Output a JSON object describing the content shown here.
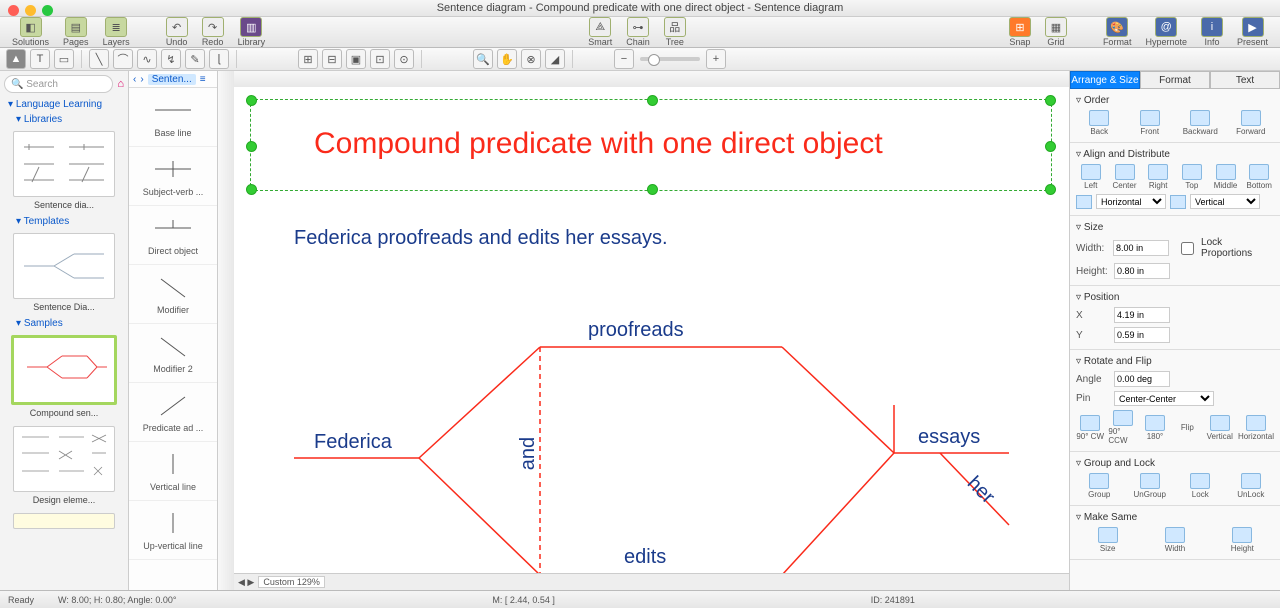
{
  "window": {
    "title": "Sentence diagram - Compound predicate with one direct object - Sentence diagram",
    "traffic": {
      "close": "#ff5f57",
      "min": "#febc2e",
      "max": "#28c840"
    }
  },
  "toolbar": {
    "left": [
      {
        "label": "Solutions",
        "icon": "📦"
      },
      {
        "label": "Pages",
        "icon": "📄"
      },
      {
        "label": "Layers",
        "icon": "📚"
      }
    ],
    "undo": "Undo",
    "redo": "Redo",
    "library": "Library",
    "mid": [
      {
        "label": "Smart",
        "icon": "▵"
      },
      {
        "label": "Chain",
        "icon": "⛓"
      },
      {
        "label": "Tree",
        "icon": "品"
      }
    ],
    "snap": "Snap",
    "grid": "Grid",
    "right": [
      {
        "label": "Format",
        "icon": "🎨"
      },
      {
        "label": "Hypernote",
        "icon": "🔗"
      },
      {
        "label": "Info",
        "icon": "ℹ"
      },
      {
        "label": "Present",
        "icon": "▶"
      }
    ]
  },
  "left": {
    "search_placeholder": "Search",
    "section_main": "Language Learning",
    "sections": [
      "Libraries",
      "Templates",
      "Samples"
    ],
    "thumbs": [
      {
        "label": "Sentence dia..."
      },
      {
        "label": "Sentence Dia..."
      },
      {
        "label": "Compound sen...",
        "selected": true
      },
      {
        "label": "Design eleme..."
      }
    ]
  },
  "lib": {
    "nav": "Senten...",
    "items": [
      "Base line",
      "Subject-verb ...",
      "Direct object",
      "Modifier",
      "Modifier 2",
      "Predicate ad ...",
      "Vertical line",
      "Up-vertical line"
    ]
  },
  "canvas": {
    "title": "Compound predicate with one direct object",
    "sentence": "Federica proofreads and edits her essays.",
    "labels": {
      "subject": "Federica",
      "verb1": "proofreads",
      "verb2": "edits",
      "conj": "and",
      "obj": "essays",
      "mod": "her"
    },
    "zoom": "Custom 129%"
  },
  "right": {
    "tabs": [
      "Arrange & Size",
      "Format",
      "Text"
    ],
    "order": {
      "hdr": "Order",
      "items": [
        "Back",
        "Front",
        "Backward",
        "Forward"
      ]
    },
    "align": {
      "hdr": "Align and Distribute",
      "items": [
        "Left",
        "Center",
        "Right",
        "Top",
        "Middle",
        "Bottom"
      ],
      "h": "Horizontal",
      "v": "Vertical"
    },
    "size": {
      "hdr": "Size",
      "width_lbl": "Width:",
      "width": "8.00 in",
      "height_lbl": "Height:",
      "height": "0.80 in",
      "lock": "Lock Proportions"
    },
    "pos": {
      "hdr": "Position",
      "x_lbl": "X",
      "x": "4.19 in",
      "y_lbl": "Y",
      "y": "0.59 in"
    },
    "rotate": {
      "hdr": "Rotate and Flip",
      "angle_lbl": "Angle",
      "angle": "0.00 deg",
      "pin_lbl": "Pin",
      "pin": "Center-Center",
      "items": [
        "90° CW",
        "90° CCW",
        "180°",
        "Flip",
        "Vertical",
        "Horizontal"
      ]
    },
    "group": {
      "hdr": "Group and Lock",
      "items": [
        "Group",
        "UnGroup",
        "Lock",
        "UnLock"
      ]
    },
    "same": {
      "hdr": "Make Same",
      "items": [
        "Size",
        "Width",
        "Height"
      ]
    }
  },
  "status": {
    "ready": "Ready",
    "wh": "W: 8.00;  H: 0.80;  Angle: 0.00°",
    "m": "M: [ 2.44, 0.54 ]",
    "id": "ID: 241891"
  }
}
